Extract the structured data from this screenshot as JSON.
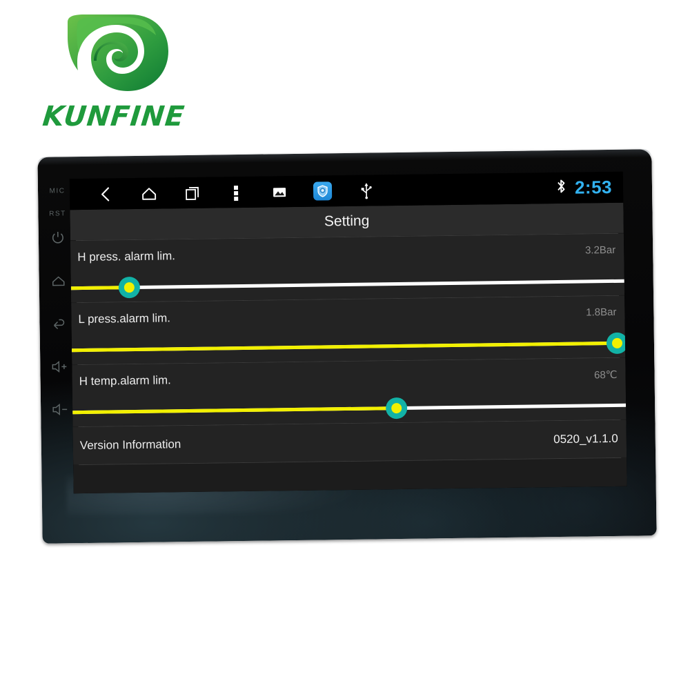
{
  "brand": {
    "name": "KUNFINE",
    "logo_color": "#1f9a3c",
    "mark_icon": "swirl-leaf-logo"
  },
  "device": {
    "bezel_keys": [
      {
        "id": "mic",
        "label": "MIC",
        "icon": ""
      },
      {
        "id": "rst",
        "label": "RST",
        "icon": ""
      },
      {
        "id": "power",
        "label": "",
        "icon": "power-icon"
      },
      {
        "id": "home",
        "label": "",
        "icon": "home-icon"
      },
      {
        "id": "back",
        "label": "",
        "icon": "back-arrow-icon"
      },
      {
        "id": "volume-up",
        "label": "",
        "icon": "volume-up-icon"
      },
      {
        "id": "volume-down",
        "label": "",
        "icon": "volume-down-icon"
      }
    ]
  },
  "statusbar": {
    "nav_items": [
      {
        "id": "back",
        "icon": "back-chevron-icon"
      },
      {
        "id": "home",
        "icon": "home-icon"
      },
      {
        "id": "recents",
        "icon": "recent-apps-icon"
      },
      {
        "id": "menu",
        "icon": "overflow-menu-icon"
      },
      {
        "id": "gallery",
        "icon": "image-icon"
      },
      {
        "id": "security-app",
        "icon": "shield-app-icon"
      },
      {
        "id": "usb",
        "icon": "usb-icon"
      }
    ],
    "bluetooth_icon": "bluetooth-icon",
    "time": "2:53",
    "time_color": "#32b2f0"
  },
  "title": "Setting",
  "settings": {
    "rows": [
      {
        "label": "H press. alarm lim.",
        "value": "3.2Bar",
        "slider_percent": 10.5,
        "track_color": "#f2f000",
        "thumb_ring_color": "#12b2a6",
        "thumb_core_color": "#f2f000"
      },
      {
        "label": "L press.alarm lim.",
        "value": "1.8Bar",
        "slider_percent": 98.5,
        "track_color": "#f2f000",
        "thumb_ring_color": "#12b2a6",
        "thumb_core_color": "#f2f000"
      },
      {
        "label": "H temp.alarm lim.",
        "value": "68℃",
        "slider_percent": 58.5,
        "track_color": "#f2f000",
        "thumb_ring_color": "#12b2a6",
        "thumb_core_color": "#f2f000"
      }
    ],
    "version_row": {
      "label": "Version Information",
      "value": "0520_v1.1.0"
    }
  }
}
